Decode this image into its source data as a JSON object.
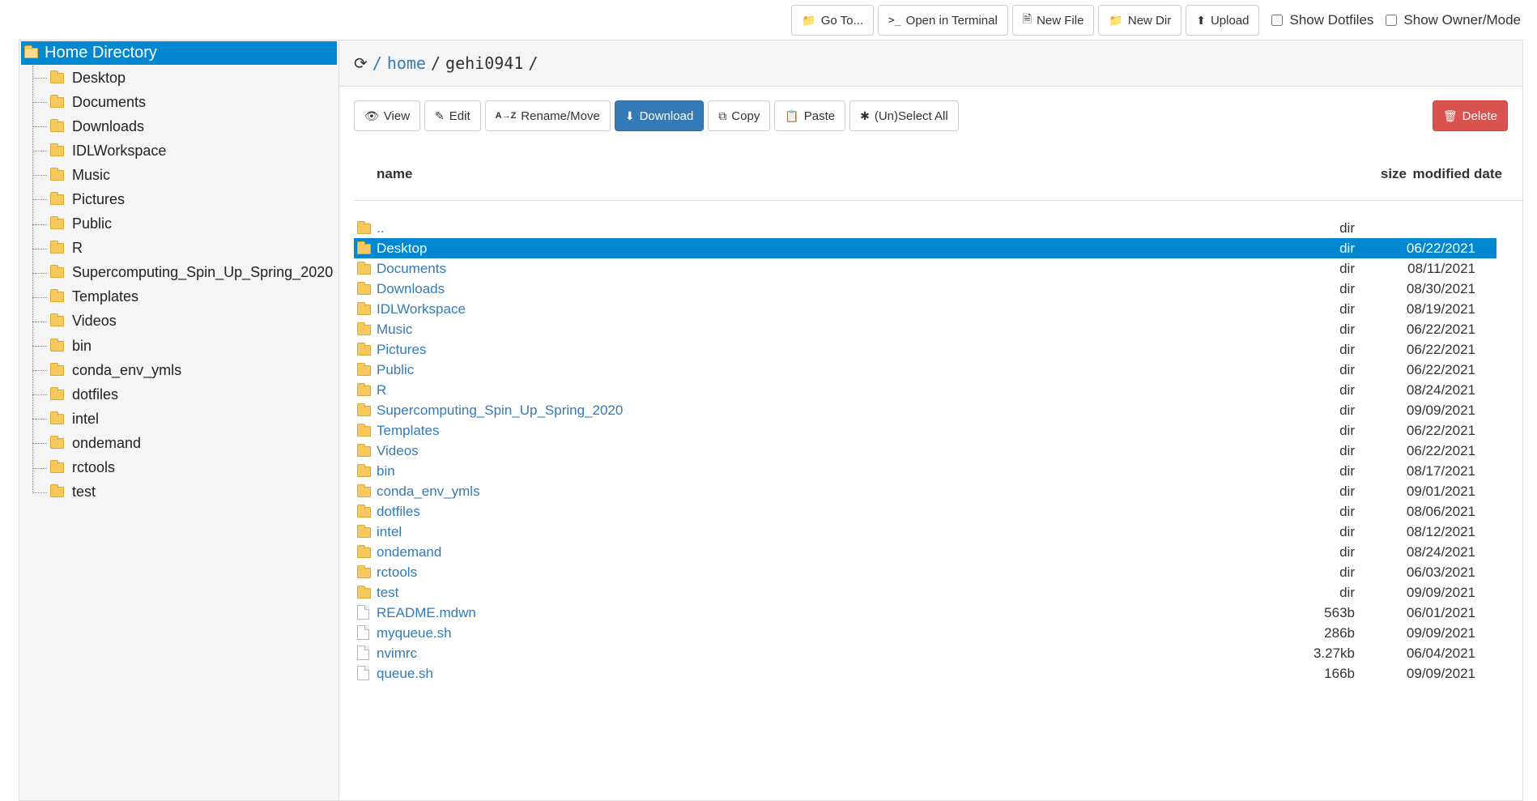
{
  "toolbar": {
    "goto": "Go To...",
    "terminal": "Open in Terminal",
    "new_file": "New File",
    "new_dir": "New Dir",
    "upload": "Upload",
    "show_dotfiles": "Show Dotfiles",
    "show_owner_mode": "Show Owner/Mode"
  },
  "sidebar": {
    "root_label": "Home Directory",
    "items": [
      {
        "label": "Desktop"
      },
      {
        "label": "Documents"
      },
      {
        "label": "Downloads"
      },
      {
        "label": "IDLWorkspace"
      },
      {
        "label": "Music"
      },
      {
        "label": "Pictures"
      },
      {
        "label": "Public"
      },
      {
        "label": "R"
      },
      {
        "label": "Supercomputing_Spin_Up_Spring_2020"
      },
      {
        "label": "Templates"
      },
      {
        "label": "Videos"
      },
      {
        "label": "bin"
      },
      {
        "label": "conda_env_ymls"
      },
      {
        "label": "dotfiles"
      },
      {
        "label": "intel"
      },
      {
        "label": "ondemand"
      },
      {
        "label": "rctools"
      },
      {
        "label": "test"
      }
    ]
  },
  "path": {
    "sep1": "/",
    "home": "home",
    "sep2": "/",
    "user": "gehi0941",
    "sep3": "/"
  },
  "actions": {
    "view": "View",
    "edit": "Edit",
    "rename": "Rename/Move",
    "download": "Download",
    "copy": "Copy",
    "paste": "Paste",
    "select_all": "(Un)Select All",
    "delete": "Delete"
  },
  "table": {
    "headers": {
      "name": "name",
      "size": "size",
      "modified": "modified date"
    },
    "rows": [
      {
        "name": "..",
        "size": "dir",
        "date": "",
        "type": "dir"
      },
      {
        "name": "Desktop",
        "size": "dir",
        "date": "06/22/2021",
        "type": "dir",
        "selected": true
      },
      {
        "name": "Documents",
        "size": "dir",
        "date": "08/11/2021",
        "type": "dir"
      },
      {
        "name": "Downloads",
        "size": "dir",
        "date": "08/30/2021",
        "type": "dir"
      },
      {
        "name": "IDLWorkspace",
        "size": "dir",
        "date": "08/19/2021",
        "type": "dir"
      },
      {
        "name": "Music",
        "size": "dir",
        "date": "06/22/2021",
        "type": "dir"
      },
      {
        "name": "Pictures",
        "size": "dir",
        "date": "06/22/2021",
        "type": "dir"
      },
      {
        "name": "Public",
        "size": "dir",
        "date": "06/22/2021",
        "type": "dir"
      },
      {
        "name": "R",
        "size": "dir",
        "date": "08/24/2021",
        "type": "dir"
      },
      {
        "name": "Supercomputing_Spin_Up_Spring_2020",
        "size": "dir",
        "date": "09/09/2021",
        "type": "dir"
      },
      {
        "name": "Templates",
        "size": "dir",
        "date": "06/22/2021",
        "type": "dir"
      },
      {
        "name": "Videos",
        "size": "dir",
        "date": "06/22/2021",
        "type": "dir"
      },
      {
        "name": "bin",
        "size": "dir",
        "date": "08/17/2021",
        "type": "dir"
      },
      {
        "name": "conda_env_ymls",
        "size": "dir",
        "date": "09/01/2021",
        "type": "dir"
      },
      {
        "name": "dotfiles",
        "size": "dir",
        "date": "08/06/2021",
        "type": "dir"
      },
      {
        "name": "intel",
        "size": "dir",
        "date": "08/12/2021",
        "type": "dir"
      },
      {
        "name": "ondemand",
        "size": "dir",
        "date": "08/24/2021",
        "type": "dir"
      },
      {
        "name": "rctools",
        "size": "dir",
        "date": "06/03/2021",
        "type": "dir"
      },
      {
        "name": "test",
        "size": "dir",
        "date": "09/09/2021",
        "type": "dir"
      },
      {
        "name": "README.mdwn",
        "size": "563b",
        "date": "06/01/2021",
        "type": "file"
      },
      {
        "name": "myqueue.sh",
        "size": "286b",
        "date": "09/09/2021",
        "type": "file"
      },
      {
        "name": "nvimrc",
        "size": "3.27kb",
        "date": "06/04/2021",
        "type": "file"
      },
      {
        "name": "queue.sh",
        "size": "166b",
        "date": "09/09/2021",
        "type": "file"
      }
    ]
  },
  "colors": {
    "selection": "#0288d1",
    "link": "#337ab7",
    "primary_button": "#337ab7",
    "danger_button": "#d9534f"
  }
}
